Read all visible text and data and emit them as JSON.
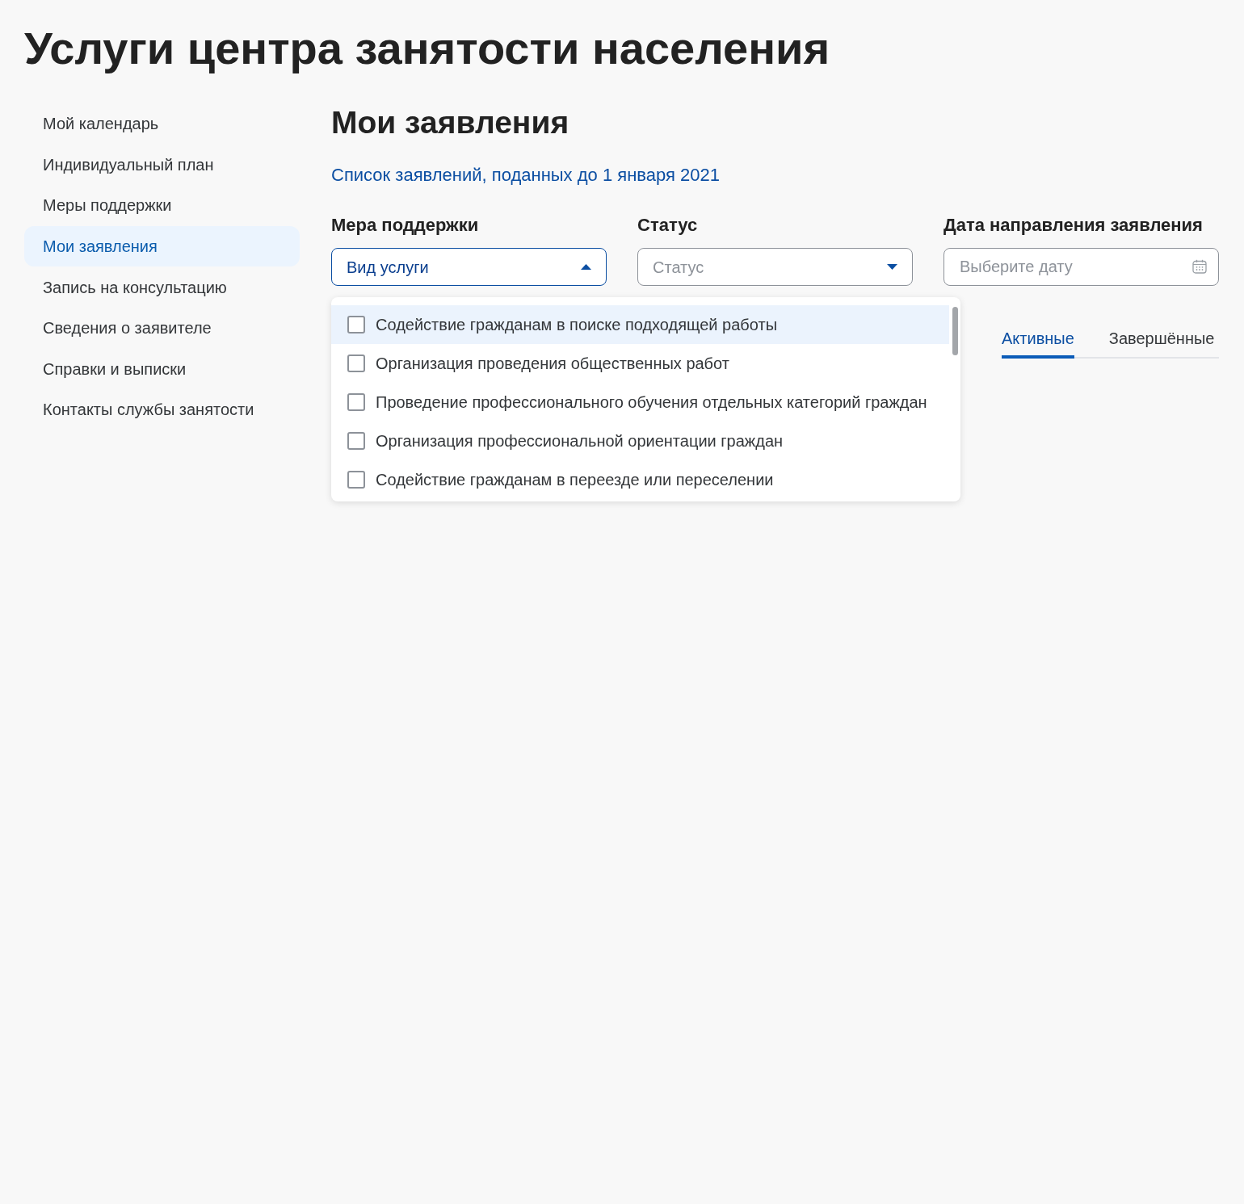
{
  "page": {
    "title": "Услуги центра занятости населения"
  },
  "sidebar": {
    "items": [
      {
        "label": "Мой календарь",
        "selected": false
      },
      {
        "label": "Индивидуальный план",
        "selected": false
      },
      {
        "label": "Меры поддержки",
        "selected": false
      },
      {
        "label": "Мои заявления",
        "selected": true
      },
      {
        "label": "Запись на консультацию",
        "selected": false
      },
      {
        "label": "Сведения о заявителе",
        "selected": false
      },
      {
        "label": "Справки и выписки",
        "selected": false
      },
      {
        "label": "Контакты службы занятости",
        "selected": false
      }
    ]
  },
  "main": {
    "heading": "Мои заявления",
    "link": "Список заявлений, поданных до 1 января 2021",
    "filters": [
      {
        "kind": "select",
        "label": "Мера поддержки",
        "value": "Вид услуги",
        "expanded": true,
        "options": [
          {
            "label": "Содействие гражданам в поиске подходящей работы",
            "checked": false,
            "highlighted": true
          },
          {
            "label": "Организация проведения общественных работ",
            "checked": false,
            "highlighted": false
          },
          {
            "label": "Проведение профессионального обучения отдельных категорий граждан",
            "checked": false,
            "highlighted": false
          },
          {
            "label": "Организация профессиональной ориентации граждан",
            "checked": false,
            "highlighted": false
          },
          {
            "label": "Содействие гражданам в переезде или переселении",
            "checked": false,
            "highlighted": false
          }
        ]
      },
      {
        "kind": "select",
        "label": "Статус",
        "placeholder": "Статус",
        "expanded": false
      },
      {
        "kind": "date",
        "label": "Дата направления заявления",
        "placeholder": "Выберите дату"
      }
    ],
    "tabs": [
      {
        "label": "Активные",
        "selected": true
      },
      {
        "label": "Завершённые",
        "selected": false
      }
    ]
  }
}
